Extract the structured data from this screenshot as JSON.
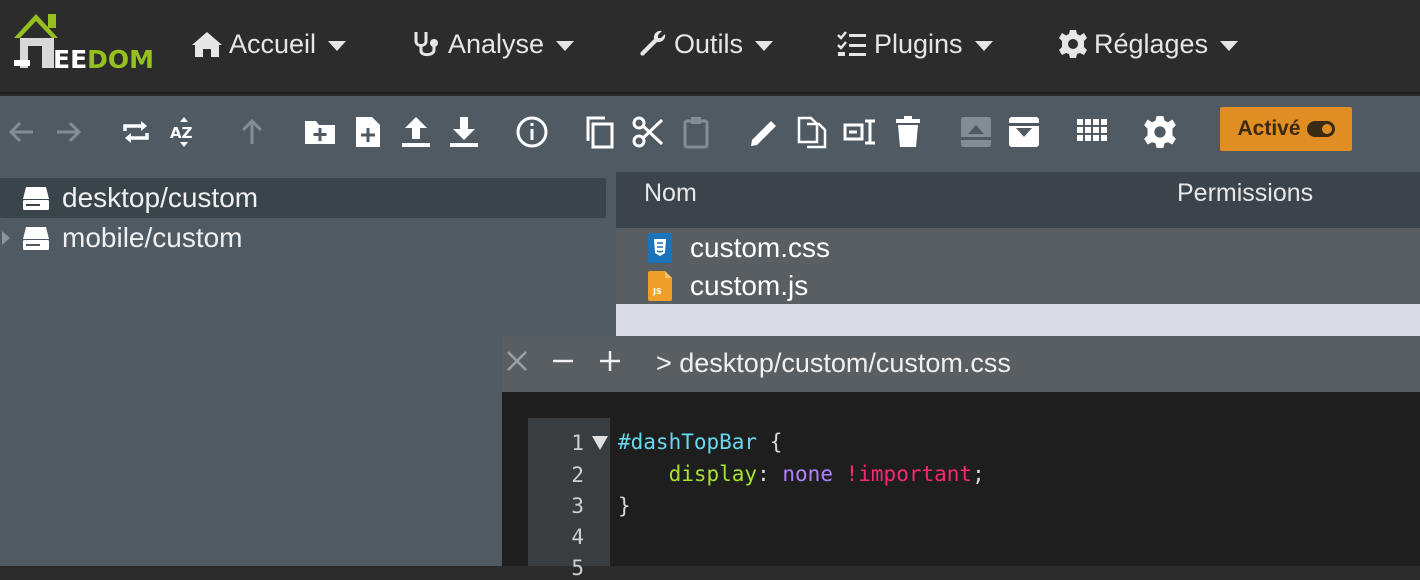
{
  "brand": {
    "logo_text_white": "J",
    "logo_text_e": "EE",
    "logo_text_green": "DOM",
    "colors": {
      "green": "#94c11f",
      "white": "#ffffff"
    }
  },
  "nav": {
    "items": [
      {
        "label": "Accueil",
        "icon": "home-icon"
      },
      {
        "label": "Analyse",
        "icon": "stethoscope-icon"
      },
      {
        "label": "Outils",
        "icon": "wrench-icon"
      },
      {
        "label": "Plugins",
        "icon": "tasks-icon"
      },
      {
        "label": "Réglages",
        "icon": "cog-icon"
      }
    ]
  },
  "toolbar": {
    "icons": [
      "back-icon",
      "forward-icon",
      "refresh-icon",
      "sort-az-icon",
      "up-icon",
      "new-folder-icon",
      "new-file-icon",
      "upload-icon",
      "download-icon",
      "info-icon",
      "copy-icon",
      "cut-icon",
      "paste-icon",
      "rename-icon",
      "duplicate-icon",
      "edit-icon",
      "delete-icon",
      "extract-icon",
      "archive-icon",
      "view-grid-icon",
      "settings-icon"
    ],
    "active_label": "Activé",
    "accent": "#e08e24"
  },
  "tree": {
    "items": [
      {
        "label": "desktop/custom",
        "selected": true
      },
      {
        "label": "mobile/custom",
        "selected": false
      }
    ]
  },
  "files": {
    "columns": {
      "name": "Nom",
      "permissions": "Permissions"
    },
    "rows": [
      {
        "name": "custom.css",
        "icon": "css-file-icon"
      },
      {
        "name": "custom.js",
        "icon": "js-file-icon"
      }
    ]
  },
  "editor": {
    "title": "> desktop/custom/custom.css",
    "line_numbers": [
      "1",
      "2",
      "3",
      "4",
      "5"
    ],
    "code": {
      "l1_sel": "#dashTopBar",
      "l1_brace": " {",
      "l2_indent": "    ",
      "l2_prop": "display",
      "l2_colon": ": ",
      "l2_val": "none",
      "l2_sp": " ",
      "l2_imp": "!important",
      "l2_semi": ";",
      "l3": "}"
    }
  }
}
